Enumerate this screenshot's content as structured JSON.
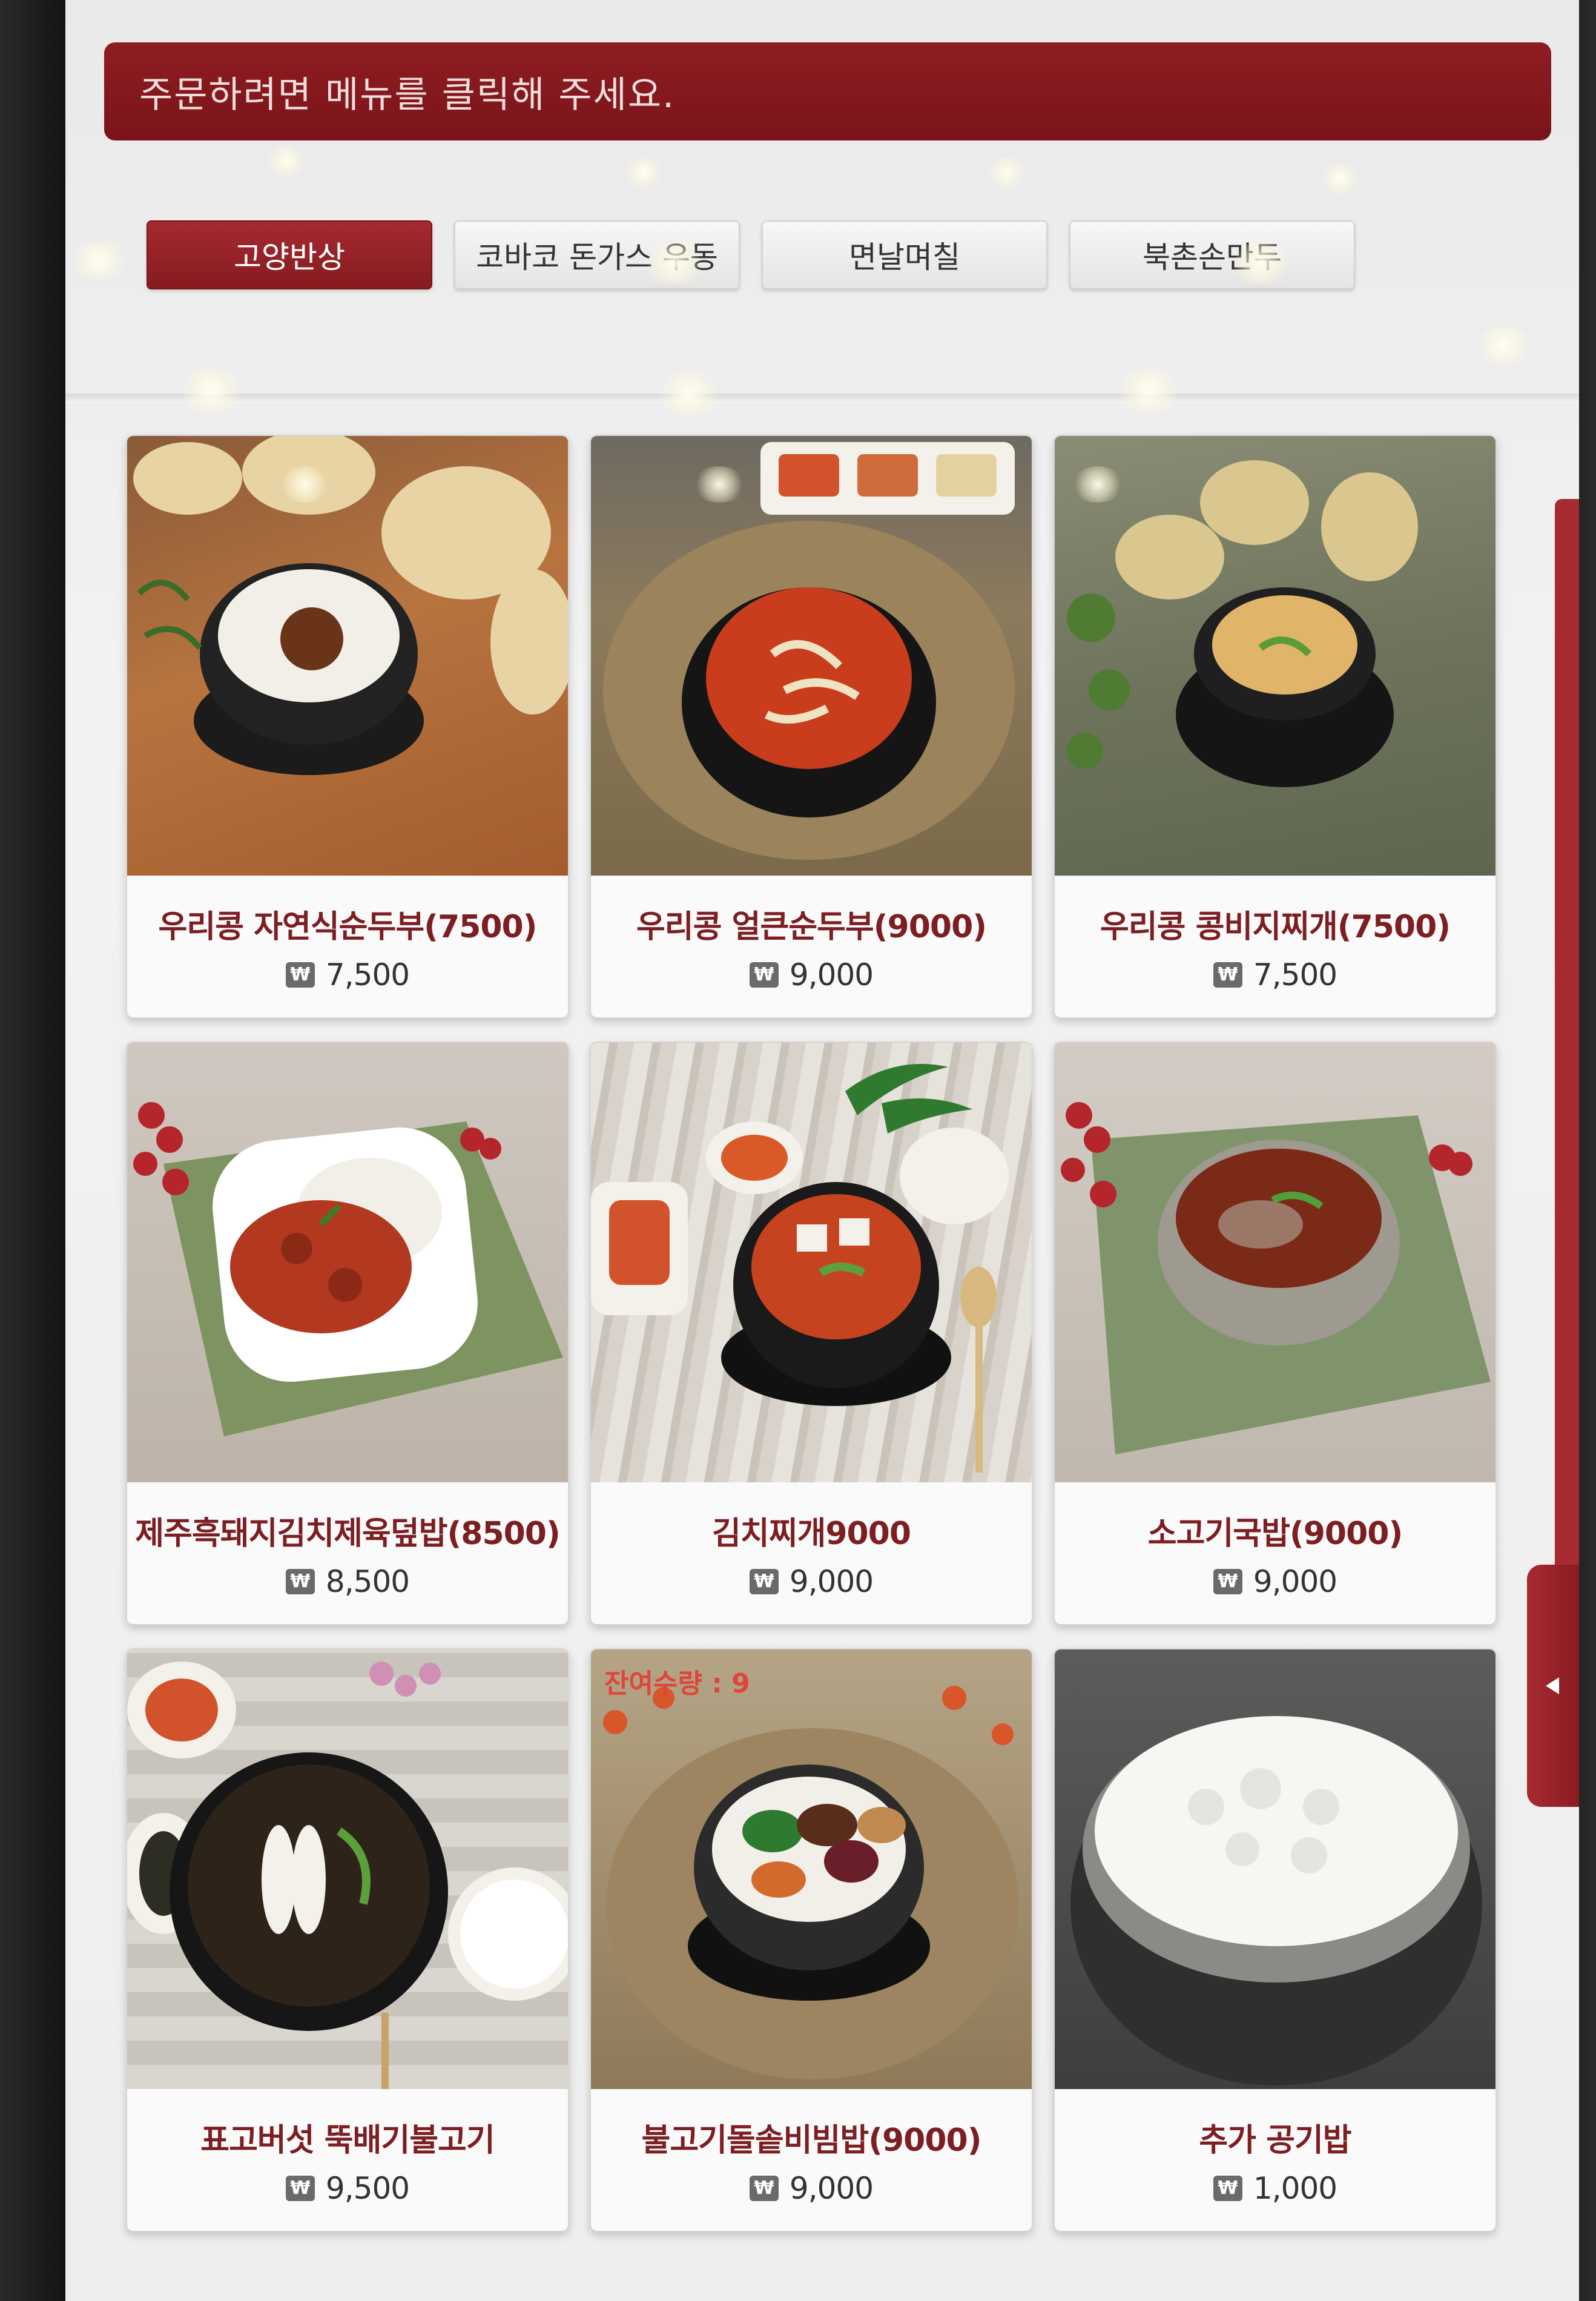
{
  "header": {
    "instruction": "주문하려면 메뉴를 클릭해 주세요."
  },
  "tabs": [
    {
      "label": "고양반상",
      "active": true
    },
    {
      "label": "코바코 돈가스 우동",
      "active": false
    },
    {
      "label": "면날며칠",
      "active": false
    },
    {
      "label": "북촌손만두",
      "active": false
    }
  ],
  "currency_symbol": "₩",
  "menu": [
    {
      "name": "우리콩 자연식순두부(7500)",
      "price": "7,500",
      "image": "soft-tofu-stew-with-rice"
    },
    {
      "name": "우리콩 얼큰순두부(9000)",
      "price": "9,000",
      "image": "spicy-soft-tofu-stew"
    },
    {
      "name": "우리콩 콩비지찌개(7500)",
      "price": "7,500",
      "image": "bean-curd-residue-stew"
    },
    {
      "name": "제주흑돼지김치제육덮밥(8500)",
      "price": "8,500",
      "image": "spicy-pork-rice-bowl"
    },
    {
      "name": "김치찌개9000",
      "price": "9,000",
      "image": "kimchi-stew"
    },
    {
      "name": "소고기국밥(9000)",
      "price": "9,000",
      "image": "beef-rice-soup"
    },
    {
      "name": "표고버섯 뚝배기불고기",
      "price": "9,500",
      "image": "mushroom-bulgogi-hotpot"
    },
    {
      "name": "불고기돌솥비빔밥(9000)",
      "price": "9,000",
      "image": "stone-pot-bibimbap",
      "image_text": "잔여수량 : 9"
    },
    {
      "name": "추가 공기밥",
      "price": "1,000",
      "image": "bowl-of-rice"
    }
  ],
  "colors": {
    "accent": "#8e1d22",
    "name_text": "#7c1e22"
  }
}
